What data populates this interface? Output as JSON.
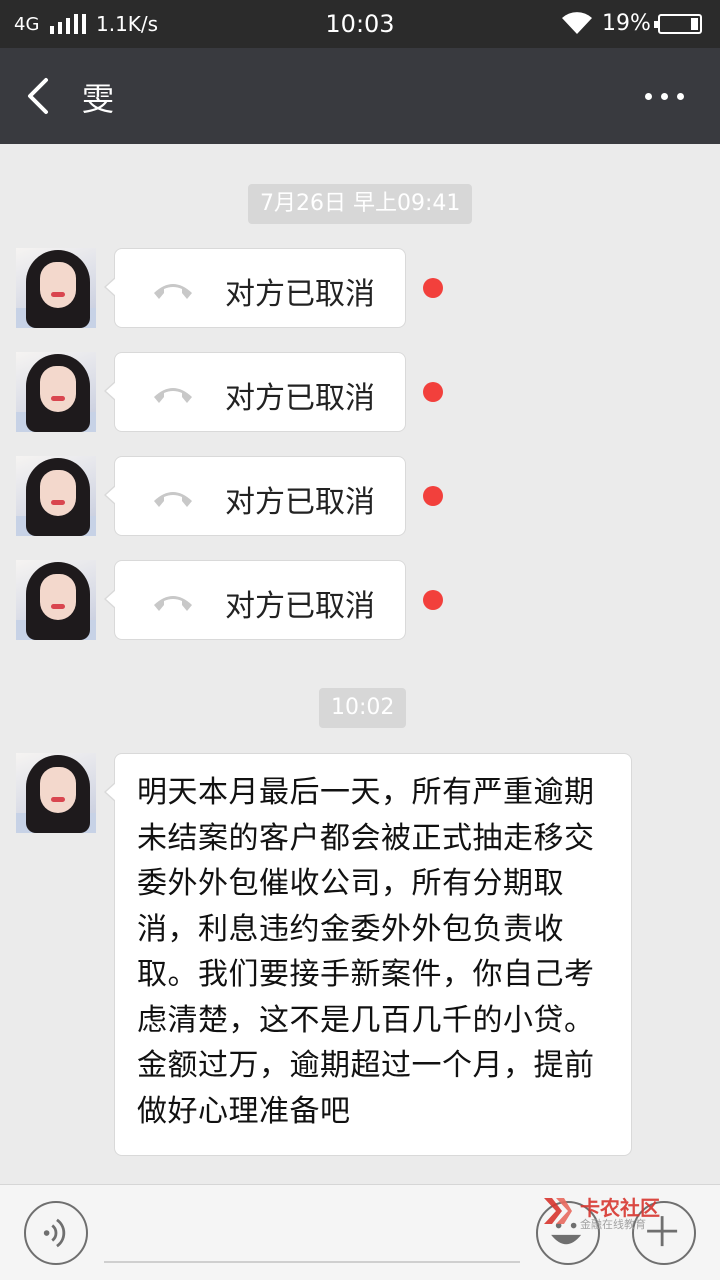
{
  "status_bar": {
    "network": "4G",
    "speed": "1.1K/s",
    "time": "10:03",
    "battery_percent": "19%",
    "battery_level": 0.19,
    "signal_icon": "signal-icon",
    "wifi_icon": "wifi-icon"
  },
  "title_bar": {
    "title": "雯",
    "back_icon": "chevron-left-icon",
    "more_icon": "more-icon"
  },
  "chat": {
    "timestamp_1": "7月26日 早上09:41",
    "call_status": "对方已取消",
    "timestamp_2": "10:02",
    "message": "明天本月最后一天，所有严重逾期未结案的客户都会被正式抽走移交委外外包催收公司，所有分期取消，利息违约金委外外包负责收取。我们要接手新案件，你自己考虑清楚，这不是几百几千的小贷。金额过万，逾期超过一个月，提前做好心理准备吧"
  },
  "input_bar": {
    "voice_icon": "voice-icon",
    "emoji_icon": "emoji-icon",
    "plus_icon": "plus-icon",
    "text_value": ""
  },
  "watermark": {
    "title": "卡农社区",
    "subtitle": "金融在线教育"
  },
  "colors": {
    "status_bar_bg": "#2b2b2b",
    "title_bar_bg": "#393a3f",
    "chat_bg": "#ebebeb",
    "unread_dot": "#f2403c",
    "watermark_red": "#d8362f"
  }
}
